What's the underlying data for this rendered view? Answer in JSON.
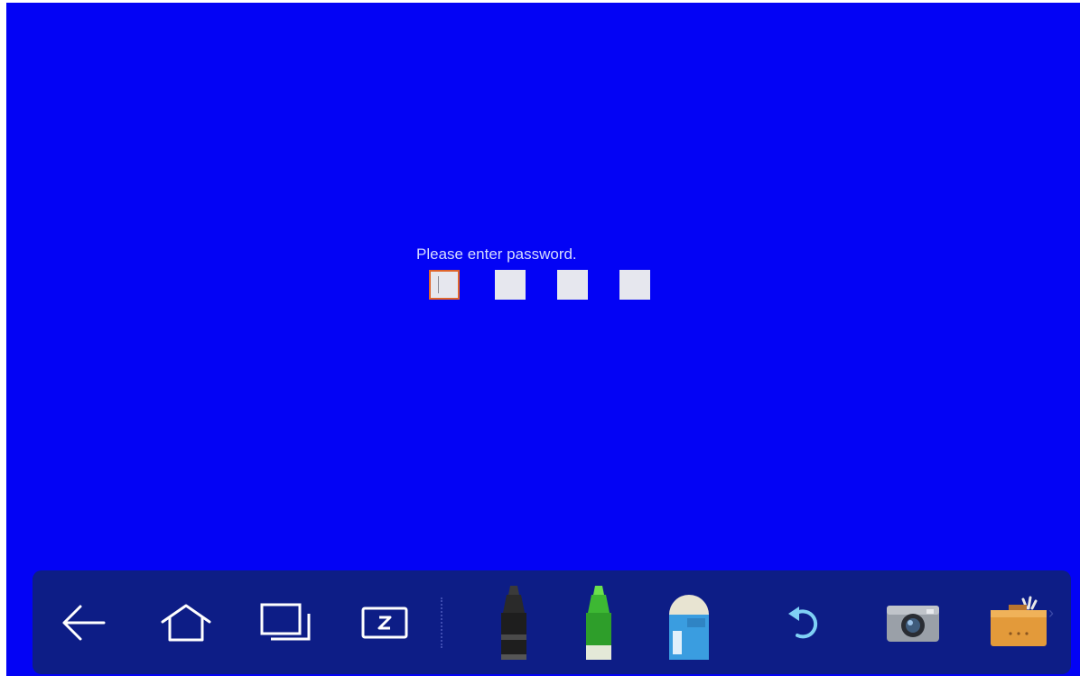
{
  "password_prompt": {
    "message": "Please enter password.",
    "digits": [
      "",
      "",
      "",
      ""
    ],
    "active_digit_index": 0
  },
  "toolbar": {
    "buttons": [
      {
        "name": "back",
        "icon": "back-arrow-icon"
      },
      {
        "name": "home",
        "icon": "home-icon"
      },
      {
        "name": "recent-apps",
        "icon": "recent-apps-icon"
      },
      {
        "name": "screen-annotation",
        "icon": "annotation-screen-icon"
      },
      {
        "name": "marker",
        "icon": "marker-pen-icon"
      },
      {
        "name": "highlighter",
        "icon": "highlighter-icon"
      },
      {
        "name": "eraser",
        "icon": "eraser-icon"
      },
      {
        "name": "undo",
        "icon": "undo-icon"
      },
      {
        "name": "screenshot",
        "icon": "camera-icon"
      },
      {
        "name": "toolbox",
        "icon": "toolbox-icon"
      }
    ]
  },
  "colors": {
    "screen_background": "#0303f5",
    "toolbar_background": "#0d1d86",
    "active_box_border": "#e0652a"
  }
}
